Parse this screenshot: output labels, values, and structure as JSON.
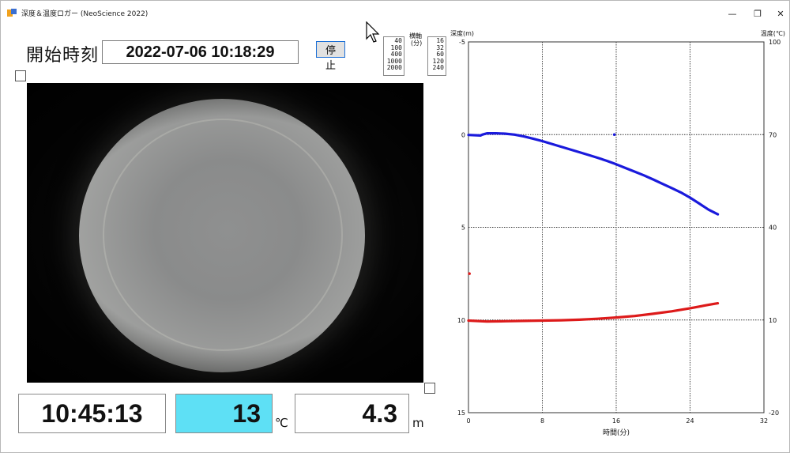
{
  "window": {
    "title": "深度＆温度ロガー (NeoScience 2022)",
    "minimize_glyph": "—",
    "restore_glyph": "❐",
    "close_glyph": "✕"
  },
  "header": {
    "start_label": "開始時刻",
    "start_time": "2022-07-06  10:18:29",
    "stop_button": "停止"
  },
  "scales": {
    "left_label": "",
    "left_options": [
      "40",
      "100",
      "400",
      "1000",
      "2000"
    ],
    "right_label_1": "横軸",
    "right_label_2": "(分)",
    "right_options": [
      "16",
      "32",
      "60",
      "120",
      "240"
    ]
  },
  "readouts": {
    "clock": "10:45:13",
    "temperature": "13",
    "temperature_unit": "℃",
    "depth": "4.3",
    "depth_unit": "m",
    "temperature_bg": "#5ee0f5"
  },
  "chart_data": {
    "type": "line",
    "ylabel_left": "深度(m)",
    "ylabel_right": "温度(℃)",
    "xlabel": "時間(分)",
    "x_ticks": [
      "0",
      "8",
      "16",
      "24",
      "32"
    ],
    "x_range": [
      0,
      32
    ],
    "y_left_ticks": [
      "-5",
      "0",
      "5",
      "10",
      "15"
    ],
    "y_left_range": [
      -5,
      15
    ],
    "y_right_ticks": [
      "100",
      "70",
      "40",
      "10",
      "-20"
    ],
    "y_right_range": [
      -20,
      100
    ],
    "grid": true,
    "series": [
      {
        "color": "#1a1adc",
        "axis": "left",
        "x": [
          0,
          1.3,
          1.5,
          2,
          3,
          4,
          5,
          6,
          7,
          8,
          9,
          10,
          11,
          12,
          13,
          14,
          15,
          16,
          17,
          18,
          19,
          20,
          21,
          22,
          23,
          24,
          25,
          26,
          27
        ],
        "y": [
          0.02,
          0.05,
          0.0,
          -0.07,
          -0.07,
          -0.05,
          0.0,
          0.1,
          0.22,
          0.35,
          0.5,
          0.65,
          0.8,
          0.95,
          1.1,
          1.25,
          1.42,
          1.6,
          1.8,
          2.0,
          2.2,
          2.42,
          2.65,
          2.88,
          3.12,
          3.4,
          3.72,
          4.05,
          4.3
        ]
      },
      {
        "color": "#dd1a1a",
        "axis": "right",
        "x": [
          0,
          2,
          4,
          6,
          8,
          10,
          12,
          14,
          16,
          18,
          20,
          22,
          24,
          26,
          27
        ],
        "y": [
          9.8,
          9.5,
          9.6,
          9.7,
          9.8,
          9.9,
          10.1,
          10.4,
          10.8,
          11.3,
          12.0,
          12.8,
          13.8,
          14.9,
          15.4
        ]
      }
    ],
    "markers": [
      {
        "axis": "left",
        "x": 15.8,
        "y": 0.0,
        "color": "#1a1adc"
      },
      {
        "axis": "right",
        "x": 0.1,
        "y": 25,
        "color": "#dd1a1a"
      }
    ]
  }
}
